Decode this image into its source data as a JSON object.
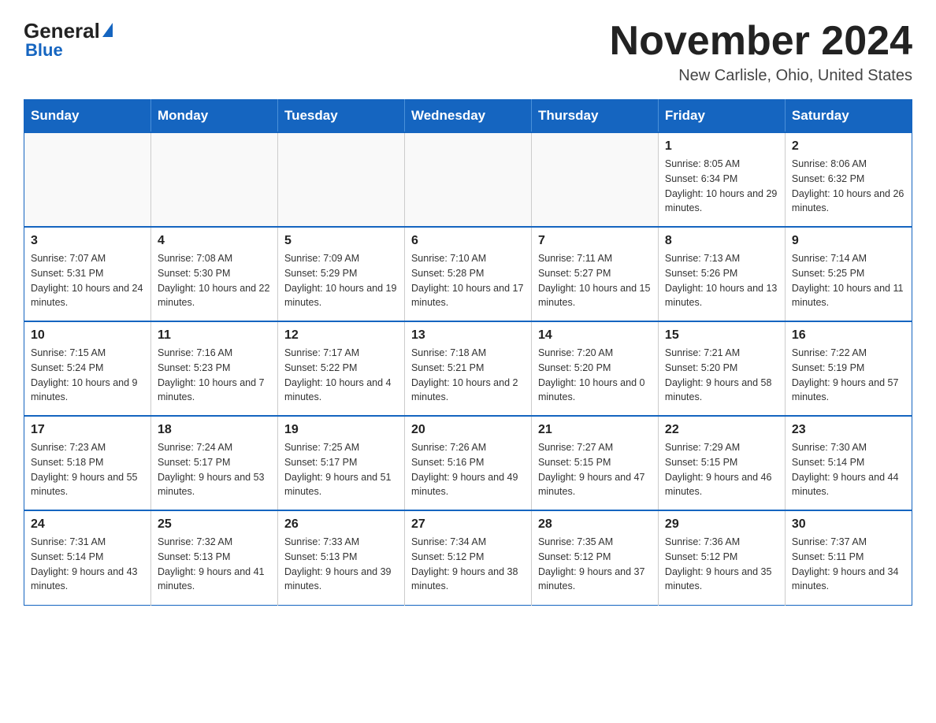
{
  "header": {
    "logo_general": "General",
    "logo_blue": "Blue",
    "title": "November 2024",
    "subtitle": "New Carlisle, Ohio, United States"
  },
  "calendar": {
    "days_of_week": [
      "Sunday",
      "Monday",
      "Tuesday",
      "Wednesday",
      "Thursday",
      "Friday",
      "Saturday"
    ],
    "weeks": [
      [
        {
          "day": "",
          "info": ""
        },
        {
          "day": "",
          "info": ""
        },
        {
          "day": "",
          "info": ""
        },
        {
          "day": "",
          "info": ""
        },
        {
          "day": "",
          "info": ""
        },
        {
          "day": "1",
          "info": "Sunrise: 8:05 AM\nSunset: 6:34 PM\nDaylight: 10 hours and 29 minutes."
        },
        {
          "day": "2",
          "info": "Sunrise: 8:06 AM\nSunset: 6:32 PM\nDaylight: 10 hours and 26 minutes."
        }
      ],
      [
        {
          "day": "3",
          "info": "Sunrise: 7:07 AM\nSunset: 5:31 PM\nDaylight: 10 hours and 24 minutes."
        },
        {
          "day": "4",
          "info": "Sunrise: 7:08 AM\nSunset: 5:30 PM\nDaylight: 10 hours and 22 minutes."
        },
        {
          "day": "5",
          "info": "Sunrise: 7:09 AM\nSunset: 5:29 PM\nDaylight: 10 hours and 19 minutes."
        },
        {
          "day": "6",
          "info": "Sunrise: 7:10 AM\nSunset: 5:28 PM\nDaylight: 10 hours and 17 minutes."
        },
        {
          "day": "7",
          "info": "Sunrise: 7:11 AM\nSunset: 5:27 PM\nDaylight: 10 hours and 15 minutes."
        },
        {
          "day": "8",
          "info": "Sunrise: 7:13 AM\nSunset: 5:26 PM\nDaylight: 10 hours and 13 minutes."
        },
        {
          "day": "9",
          "info": "Sunrise: 7:14 AM\nSunset: 5:25 PM\nDaylight: 10 hours and 11 minutes."
        }
      ],
      [
        {
          "day": "10",
          "info": "Sunrise: 7:15 AM\nSunset: 5:24 PM\nDaylight: 10 hours and 9 minutes."
        },
        {
          "day": "11",
          "info": "Sunrise: 7:16 AM\nSunset: 5:23 PM\nDaylight: 10 hours and 7 minutes."
        },
        {
          "day": "12",
          "info": "Sunrise: 7:17 AM\nSunset: 5:22 PM\nDaylight: 10 hours and 4 minutes."
        },
        {
          "day": "13",
          "info": "Sunrise: 7:18 AM\nSunset: 5:21 PM\nDaylight: 10 hours and 2 minutes."
        },
        {
          "day": "14",
          "info": "Sunrise: 7:20 AM\nSunset: 5:20 PM\nDaylight: 10 hours and 0 minutes."
        },
        {
          "day": "15",
          "info": "Sunrise: 7:21 AM\nSunset: 5:20 PM\nDaylight: 9 hours and 58 minutes."
        },
        {
          "day": "16",
          "info": "Sunrise: 7:22 AM\nSunset: 5:19 PM\nDaylight: 9 hours and 57 minutes."
        }
      ],
      [
        {
          "day": "17",
          "info": "Sunrise: 7:23 AM\nSunset: 5:18 PM\nDaylight: 9 hours and 55 minutes."
        },
        {
          "day": "18",
          "info": "Sunrise: 7:24 AM\nSunset: 5:17 PM\nDaylight: 9 hours and 53 minutes."
        },
        {
          "day": "19",
          "info": "Sunrise: 7:25 AM\nSunset: 5:17 PM\nDaylight: 9 hours and 51 minutes."
        },
        {
          "day": "20",
          "info": "Sunrise: 7:26 AM\nSunset: 5:16 PM\nDaylight: 9 hours and 49 minutes."
        },
        {
          "day": "21",
          "info": "Sunrise: 7:27 AM\nSunset: 5:15 PM\nDaylight: 9 hours and 47 minutes."
        },
        {
          "day": "22",
          "info": "Sunrise: 7:29 AM\nSunset: 5:15 PM\nDaylight: 9 hours and 46 minutes."
        },
        {
          "day": "23",
          "info": "Sunrise: 7:30 AM\nSunset: 5:14 PM\nDaylight: 9 hours and 44 minutes."
        }
      ],
      [
        {
          "day": "24",
          "info": "Sunrise: 7:31 AM\nSunset: 5:14 PM\nDaylight: 9 hours and 43 minutes."
        },
        {
          "day": "25",
          "info": "Sunrise: 7:32 AM\nSunset: 5:13 PM\nDaylight: 9 hours and 41 minutes."
        },
        {
          "day": "26",
          "info": "Sunrise: 7:33 AM\nSunset: 5:13 PM\nDaylight: 9 hours and 39 minutes."
        },
        {
          "day": "27",
          "info": "Sunrise: 7:34 AM\nSunset: 5:12 PM\nDaylight: 9 hours and 38 minutes."
        },
        {
          "day": "28",
          "info": "Sunrise: 7:35 AM\nSunset: 5:12 PM\nDaylight: 9 hours and 37 minutes."
        },
        {
          "day": "29",
          "info": "Sunrise: 7:36 AM\nSunset: 5:12 PM\nDaylight: 9 hours and 35 minutes."
        },
        {
          "day": "30",
          "info": "Sunrise: 7:37 AM\nSunset: 5:11 PM\nDaylight: 9 hours and 34 minutes."
        }
      ]
    ]
  }
}
